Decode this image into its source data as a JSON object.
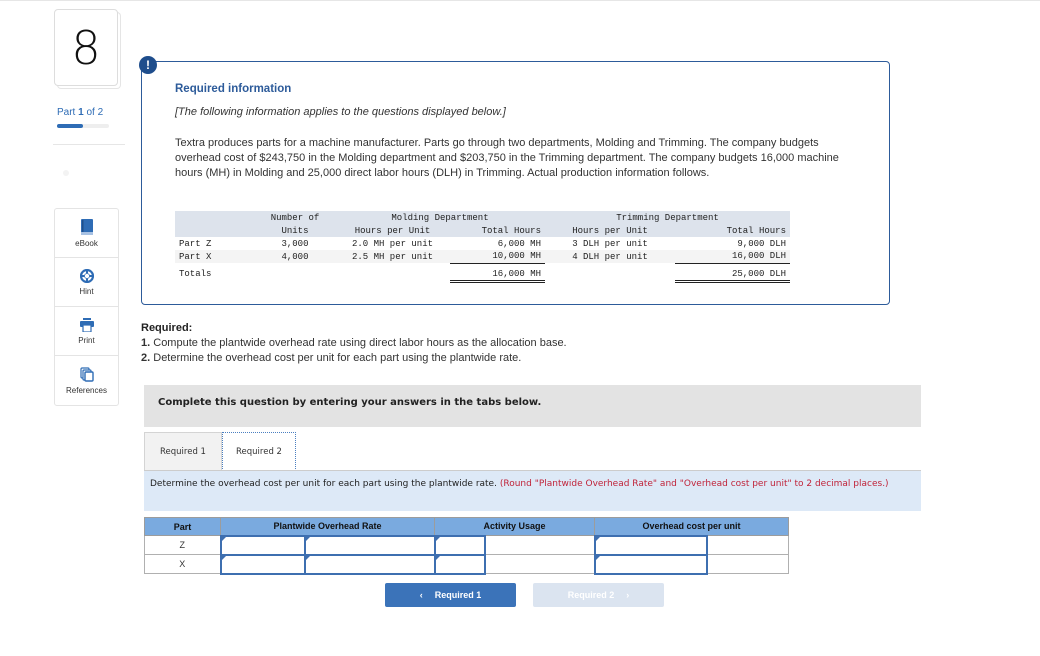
{
  "question": {
    "number": "8",
    "part_label_prefix": "Part",
    "part_current": "1",
    "part_label_of": "of 2",
    "part_progress_fraction": 0.5
  },
  "tools": [
    {
      "label": "eBook",
      "icon": "book-icon"
    },
    {
      "label": "Hint",
      "icon": "lifebuoy-icon"
    },
    {
      "label": "Print",
      "icon": "printer-icon"
    },
    {
      "label": "References",
      "icon": "copy-pages-icon"
    }
  ],
  "info": {
    "alert_glyph": "!",
    "title": "Required information",
    "note": "[The following information applies to the questions displayed below.]",
    "body": "Textra produces parts for a machine manufacturer. Parts go through two departments, Molding and Trimming. The company budgets overhead cost of $243,750 in the Molding department and $203,750 in the Trimming department. The company budgets 16,000 machine hours (MH) in Molding and 25,000 direct labor hours (DLH) in Trimming. Actual production information follows.",
    "table": {
      "header_row1": {
        "units": "Number of",
        "molding": "Molding Department",
        "trimming": "Trimming Department"
      },
      "header_row2": {
        "units": "Units",
        "m_hpu": "Hours per Unit",
        "m_total": "Total Hours",
        "t_hpu": "Hours per Unit",
        "t_total": "Total Hours"
      },
      "rows": [
        {
          "part": "Part Z",
          "units": "3,000",
          "m_hpu": "2.0 MH per unit",
          "m_total": "6,000 MH",
          "t_hpu": "3 DLH per unit",
          "t_total": "9,000 DLH"
        },
        {
          "part": "Part X",
          "units": "4,000",
          "m_hpu": "2.5 MH per unit",
          "m_total": "10,000 MH",
          "t_hpu": "4 DLH per unit",
          "t_total": "16,000 DLH"
        }
      ],
      "totals": {
        "label": "Totals",
        "m_total": "16,000 MH",
        "t_total": "25,000 DLH"
      }
    }
  },
  "required": {
    "heading": "Required:",
    "items": [
      {
        "num": "1.",
        "text": "Compute the plantwide overhead rate using direct labor hours as the allocation base."
      },
      {
        "num": "2.",
        "text": "Determine the overhead cost per unit for each part using the plantwide rate."
      }
    ]
  },
  "complete_bar": "Complete this question by entering your answers in the tabs below.",
  "tabs": [
    {
      "label": "Required 1",
      "active": false
    },
    {
      "label": "Required 2",
      "active": true
    }
  ],
  "instruction": {
    "text": "Determine the overhead cost per unit for each part using the plantwide rate.",
    "hint": "(Round \"Plantwide Overhead Rate\" and \"Overhead cost per unit\" to 2 decimal places.)"
  },
  "answer_table": {
    "headers": [
      "Part",
      "Plantwide Overhead Rate",
      "Activity Usage",
      "Overhead cost per unit"
    ],
    "rows": [
      {
        "part": "Z",
        "rate_a": "",
        "rate_b": "",
        "usage_a": "",
        "usage_b": "",
        "cost_a": "",
        "cost_b": ""
      },
      {
        "part": "X",
        "rate_a": "",
        "rate_b": "",
        "usage_a": "",
        "usage_b": "",
        "cost_a": "",
        "cost_b": ""
      }
    ]
  },
  "nav": {
    "prev_label": "Required 1",
    "prev_icon": "‹",
    "next_label": "Required 2",
    "next_icon": "›"
  }
}
